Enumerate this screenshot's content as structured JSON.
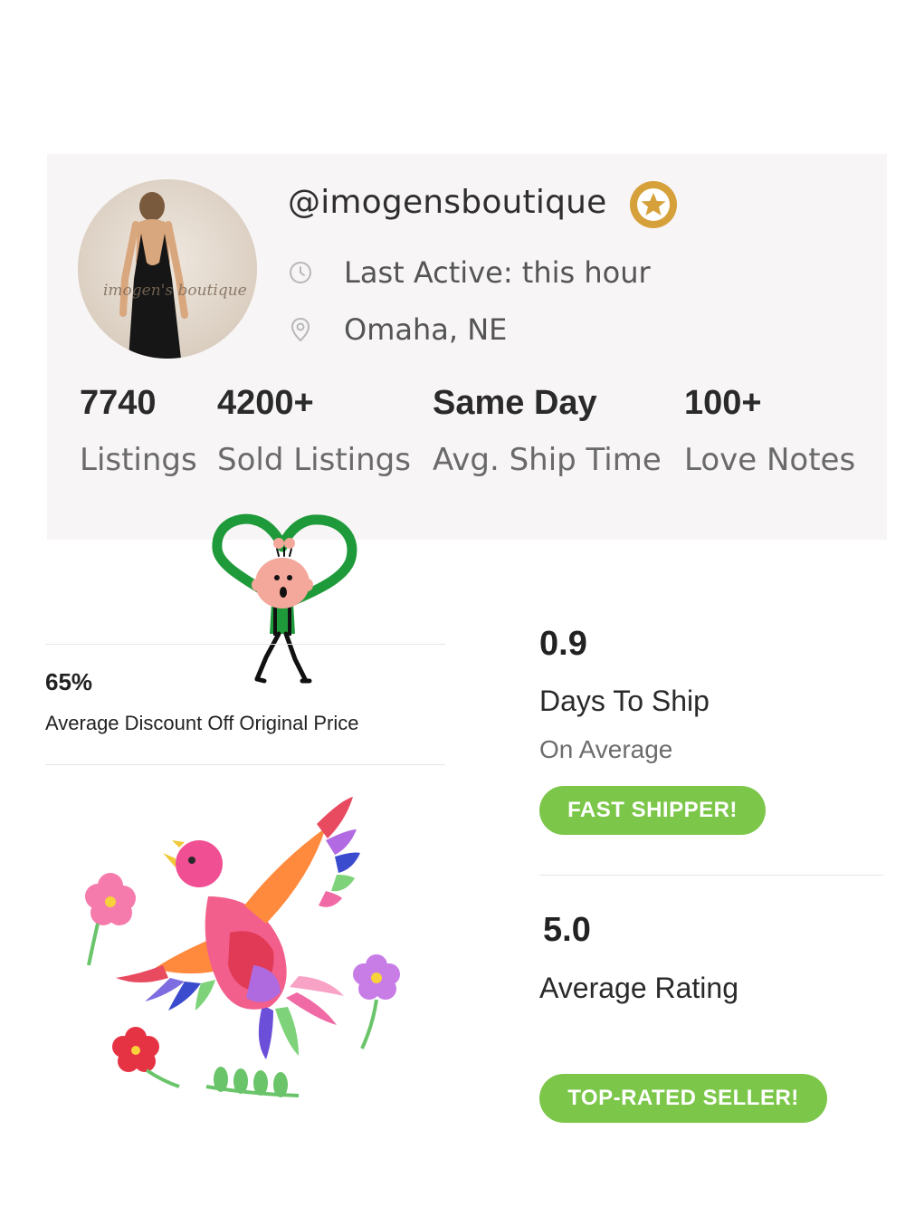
{
  "profile": {
    "username": "@imogensboutique",
    "avatar_watermark": "imogen's boutique",
    "badge_icon": "star-icon",
    "last_active": "Last Active: this hour",
    "location": "Omaha, NE"
  },
  "stats": [
    {
      "value": "7740",
      "label": "Listings"
    },
    {
      "value": "4200+",
      "label": "Sold Listings"
    },
    {
      "value": "Same Day",
      "label": "Avg. Ship Time"
    },
    {
      "value": "100+",
      "label": "Love Notes"
    }
  ],
  "discount": {
    "value": "65%",
    "label": "Average Discount Off Original Price"
  },
  "shipping": {
    "value": "0.9",
    "label": "Days To Ship",
    "sub": "On Average",
    "badge": "FAST SHIPPER!"
  },
  "rating": {
    "value": "5.0",
    "label": "Average Rating",
    "badge": "TOP-RATED SELLER!"
  },
  "colors": {
    "card_bg": "#f7f5f5",
    "badge_gold": "#d6a13b",
    "pill_green": "#7cc74a",
    "heart_green": "#1f9a3a"
  }
}
